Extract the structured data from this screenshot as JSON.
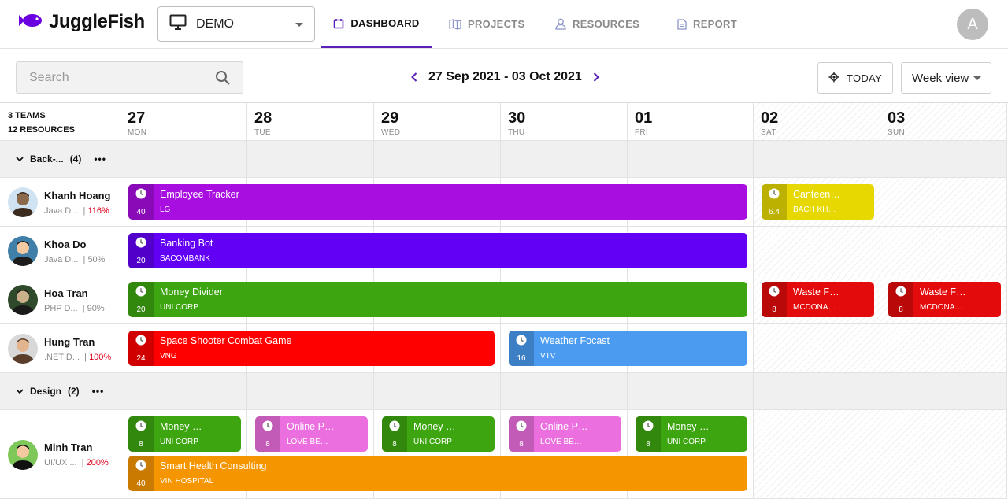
{
  "app": {
    "name": "JuggleFish",
    "avatar_initial": "A"
  },
  "workspace": {
    "selected": "DEMO"
  },
  "nav": [
    {
      "label": "DASHBOARD",
      "icon": "calendar-icon",
      "active": true
    },
    {
      "label": "PROJECTS",
      "icon": "map-icon",
      "active": false
    },
    {
      "label": "RESOURCES",
      "icon": "person-icon",
      "active": false
    },
    {
      "label": "REPORT",
      "icon": "document-icon",
      "active": false
    }
  ],
  "toolbar": {
    "search_placeholder": "Search",
    "date_range": "27 Sep 2021 - 03 Oct 2021",
    "today_label": "TODAY",
    "view_label": "Week view"
  },
  "summary": {
    "teams": "3 TEAMS",
    "resources": "12 RESOURCES"
  },
  "days": [
    {
      "num": "27",
      "name": "MON",
      "weekend": false
    },
    {
      "num": "28",
      "name": "TUE",
      "weekend": false
    },
    {
      "num": "29",
      "name": "WED",
      "weekend": false
    },
    {
      "num": "30",
      "name": "THU",
      "weekend": false
    },
    {
      "num": "01",
      "name": "FRI",
      "weekend": false
    },
    {
      "num": "02",
      "name": "SAT",
      "weekend": true
    },
    {
      "num": "03",
      "name": "SUN",
      "weekend": true
    }
  ],
  "groups": [
    {
      "label": "Back-...",
      "count": "(4)",
      "more": "•••"
    },
    {
      "label": "Design",
      "count": "(2)",
      "more": "•••"
    }
  ],
  "resources": [
    {
      "name": "Khanh Hoang",
      "role": "Java D...",
      "util": "116%",
      "over": true
    },
    {
      "name": "Khoa Do",
      "role": "Java D...",
      "util": "50%",
      "over": false
    },
    {
      "name": "Hoa Tran",
      "role": "PHP D...",
      "util": "90%",
      "over": false
    },
    {
      "name": "Hung Tran",
      "role": ".NET D...",
      "util": "100%",
      "over": true
    },
    {
      "name": "Minh Tran",
      "role": "UI/UX ...",
      "util": "200%",
      "over": true
    }
  ],
  "allocations": [
    {
      "resource": 0,
      "start": 0,
      "days": 5,
      "lane": 0,
      "title": "Employee Tracker",
      "client": "LG",
      "hours": "40",
      "color": "#a80ee0"
    },
    {
      "resource": 0,
      "start": 5,
      "days": 1,
      "lane": 0,
      "title": "Canteen…",
      "client": "BACH KH…",
      "hours": "6.4",
      "color": "#e6d800"
    },
    {
      "resource": 1,
      "start": 0,
      "days": 5,
      "lane": 0,
      "title": "Banking Bot",
      "client": "SACOMBANK",
      "hours": "20",
      "color": "#6200f5"
    },
    {
      "resource": 2,
      "start": 0,
      "days": 5,
      "lane": 0,
      "title": "Money Divider",
      "client": "UNI CORP",
      "hours": "20",
      "color": "#3da510"
    },
    {
      "resource": 2,
      "start": 5,
      "days": 1,
      "lane": 0,
      "title": "Waste F…",
      "client": "MCDONA…",
      "hours": "8",
      "color": "#e30b0b"
    },
    {
      "resource": 2,
      "start": 6,
      "days": 1,
      "lane": 0,
      "title": "Waste F…",
      "client": "MCDONA…",
      "hours": "8",
      "color": "#e30b0b"
    },
    {
      "resource": 3,
      "start": 0,
      "days": 3,
      "lane": 0,
      "title": "Space Shooter Combat Game",
      "client": "VNG",
      "hours": "24",
      "color": "#ff0000"
    },
    {
      "resource": 3,
      "start": 3,
      "days": 2,
      "lane": 0,
      "title": "Weather Focast",
      "client": "VTV",
      "hours": "16",
      "color": "#4b9cf0"
    },
    {
      "resource": 4,
      "start": 0,
      "days": 1,
      "lane": 0,
      "title": "Money …",
      "client": "UNI CORP",
      "hours": "8",
      "color": "#3da510"
    },
    {
      "resource": 4,
      "start": 1,
      "days": 1,
      "lane": 0,
      "title": "Online P…",
      "client": "LOVE BE…",
      "hours": "8",
      "color": "#ec6fe0"
    },
    {
      "resource": 4,
      "start": 2,
      "days": 1,
      "lane": 0,
      "title": "Money …",
      "client": "UNI CORP",
      "hours": "8",
      "color": "#3da510"
    },
    {
      "resource": 4,
      "start": 3,
      "days": 1,
      "lane": 0,
      "title": "Online P…",
      "client": "LOVE BE…",
      "hours": "8",
      "color": "#ec6fe0"
    },
    {
      "resource": 4,
      "start": 4,
      "days": 1,
      "lane": 0,
      "title": "Money …",
      "client": "UNI CORP",
      "hours": "8",
      "color": "#3da510"
    },
    {
      "resource": 4,
      "start": 0,
      "days": 5,
      "lane": 1,
      "title": "Smart Health Consulting",
      "client": "VIN HOSPITAL",
      "hours": "40",
      "color": "#f59600"
    }
  ]
}
